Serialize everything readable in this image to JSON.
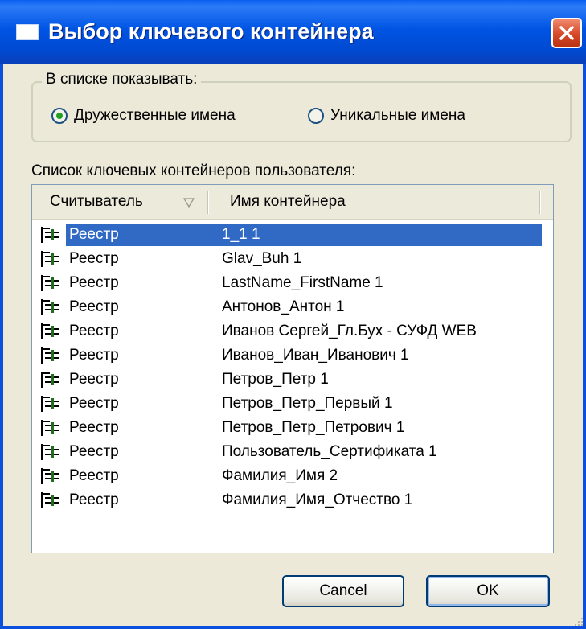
{
  "window": {
    "title": "Выбор ключевого контейнера"
  },
  "show_group": {
    "legend": "В списке показывать:",
    "options": [
      {
        "label": "Дружественные имена",
        "selected": true
      },
      {
        "label": "Уникальные имена",
        "selected": false
      }
    ]
  },
  "list": {
    "label": "Список ключевых контейнеров пользователя:",
    "columns": [
      "Считыватель",
      "Имя контейнера"
    ],
    "rows": [
      {
        "reader": "Реестр",
        "name": "1_1 1",
        "selected": true
      },
      {
        "reader": "Реестр",
        "name": "Glav_Buh 1"
      },
      {
        "reader": "Реестр",
        "name": "LastName_FirstName 1"
      },
      {
        "reader": "Реестр",
        "name": "Антонов_Антон 1"
      },
      {
        "reader": "Реестр",
        "name": "Иванов Сергей_Гл.Бух - СУФД WEB"
      },
      {
        "reader": "Реестр",
        "name": "Иванов_Иван_Иванович 1"
      },
      {
        "reader": "Реестр",
        "name": "Петров_Петр 1"
      },
      {
        "reader": "Реестр",
        "name": "Петров_Петр_Первый 1"
      },
      {
        "reader": "Реестр",
        "name": "Петров_Петр_Петрович 1"
      },
      {
        "reader": "Реестр",
        "name": "Пользователь_Сертификата 1"
      },
      {
        "reader": "Реестр",
        "name": "Фамилия_Имя 2"
      },
      {
        "reader": "Реестр",
        "name": "Фамилия_Имя_Отчество 1"
      }
    ]
  },
  "buttons": {
    "cancel": "Cancel",
    "ok": "OK"
  },
  "colors": {
    "title_bar": "#0054E3",
    "selection": "#316AC5",
    "close": "#D6482A"
  },
  "icons": {
    "title": "window-icon",
    "close": "close-icon",
    "row": "registry-icon",
    "sort": "sort-down-icon"
  }
}
